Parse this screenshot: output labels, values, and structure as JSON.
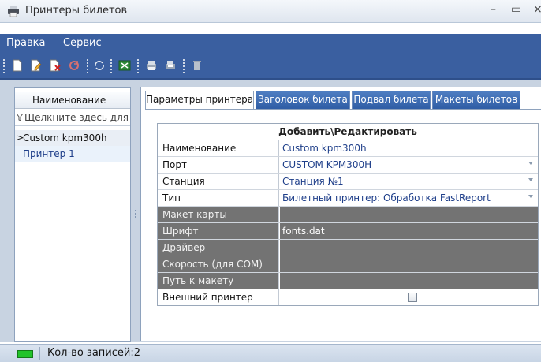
{
  "window": {
    "title": "Принтеры билетов",
    "minimize_glyph": "–",
    "maximize_glyph": "▭",
    "close_glyph": "×"
  },
  "menu": [
    "Правка",
    "Сервис"
  ],
  "toolbar": {
    "icons": [
      "new-document-icon",
      "edit-document-icon",
      "delete-document-icon",
      "refresh-icon",
      "sync-icon",
      "export-excel-icon",
      "print-icon",
      "print-preview-icon",
      "trash-icon"
    ]
  },
  "list": {
    "header": "Наименование",
    "filter_placeholder": "Щелкните здесь для",
    "rows": [
      {
        "name": "Custom kpm300h",
        "selected": true
      },
      {
        "name": "Принтер 1",
        "selected": false
      }
    ]
  },
  "tabs": [
    {
      "label": "Параметры принтера",
      "active": true
    },
    {
      "label": "Заголовок билета",
      "active": false
    },
    {
      "label": "Подвал билета",
      "active": false
    },
    {
      "label": "Макеты билетов",
      "active": false
    }
  ],
  "grid": {
    "header": "Добавить\\Редактировать",
    "rows": [
      {
        "label": "Наименование",
        "value": "Custom kpm300h",
        "dropdown": false,
        "disabled": false
      },
      {
        "label": "Порт",
        "value": "CUSTOM KPM300H",
        "dropdown": true,
        "disabled": false
      },
      {
        "label": "Станция",
        "value": "Станция №1",
        "dropdown": true,
        "disabled": false
      },
      {
        "label": "Тип",
        "value": "Билетный принтер: Обработка FastReport",
        "dropdown": true,
        "disabled": false
      },
      {
        "label": "Макет карты",
        "value": "",
        "dropdown": false,
        "disabled": true
      },
      {
        "label": "Шрифт",
        "value": "fonts.dat",
        "dropdown": false,
        "disabled": true
      },
      {
        "label": "Драйвер",
        "value": "",
        "dropdown": false,
        "disabled": true
      },
      {
        "label": "Скорость (для COM)",
        "value": "",
        "dropdown": false,
        "disabled": true
      },
      {
        "label": "Путь к макету",
        "value": "",
        "dropdown": false,
        "disabled": true
      },
      {
        "label": "Внешний принтер",
        "value": "",
        "checkbox": true,
        "checked": false,
        "disabled": false
      }
    ]
  },
  "status": {
    "records_text": "Кол-во записей:2",
    "indicator_color": "#22c32a"
  },
  "colors": {
    "menubar": "#3a5fa0",
    "tab_inactive": "#2f5da5",
    "disabled_row": "#737373",
    "selected_row": "#e2eaf6"
  }
}
